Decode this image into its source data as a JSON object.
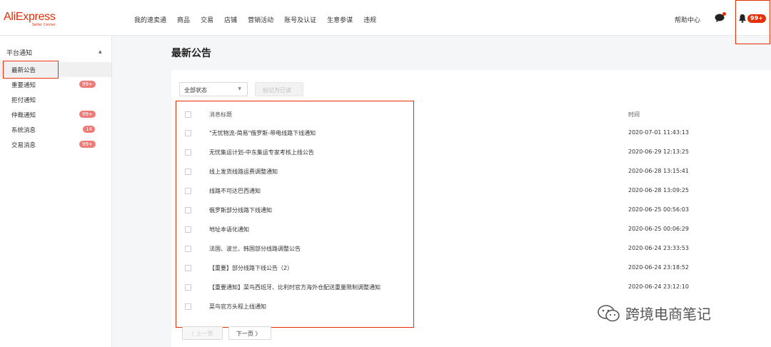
{
  "header": {
    "logo": "AliExpress",
    "logo_sub": "Seller Center",
    "nav": [
      "我的速卖通",
      "商品",
      "交易",
      "店铺",
      "营销活动",
      "账号及认证",
      "生意参谋",
      "违规"
    ],
    "help": "帮助中心",
    "bell_badge": "99+"
  },
  "sidebar": {
    "section_title": "平台通知",
    "items": [
      {
        "label": "最新公告",
        "badge": ""
      },
      {
        "label": "重要通知",
        "badge": "99+"
      },
      {
        "label": "拒付通知",
        "badge": ""
      },
      {
        "label": "仲裁通知",
        "badge": "99+"
      },
      {
        "label": "系统消息",
        "badge": "14"
      },
      {
        "label": "交易消息",
        "badge": "99+"
      }
    ]
  },
  "main": {
    "title": "最新公告",
    "filter_value": "全部状态",
    "mark_read": "标记为已读",
    "col_title": "消息标题",
    "col_time": "时间",
    "rows": [
      {
        "title": "\"无忧物流-简易\"俄罗斯-带电线路下线通知",
        "time": "2020-07-01 11:43:13"
      },
      {
        "title": "无忧集运计划-中东集运专家考核上线公告",
        "time": "2020-06-29 12:13:25"
      },
      {
        "title": "线上发货线路运费调整通知",
        "time": "2020-06-28 13:15:41"
      },
      {
        "title": "线路不可达巴西通知",
        "time": "2020-06-28 13:09:25"
      },
      {
        "title": "俄罗斯部分线路下线通知",
        "time": "2020-06-25 00:56:03"
      },
      {
        "title": "地址本语化通知",
        "time": "2020-06-25 00:06:29"
      },
      {
        "title": "法国、波兰、韩国部分线路调整公告",
        "time": "2020-06-24 23:33:53"
      },
      {
        "title": "【重要】部分线路下线公告（2）",
        "time": "2020-06-24 23:18:52"
      },
      {
        "title": "【重要通知】菜鸟西班牙、比利时官方海外仓配送重量限制调整通知",
        "time": "2020-06-24 23:12:10"
      },
      {
        "title": "菜鸟官方头程上线通知",
        "time": ""
      }
    ],
    "prev": "〈 上一页",
    "next": "下一页 〉"
  },
  "watermark": "跨境电商笔记"
}
